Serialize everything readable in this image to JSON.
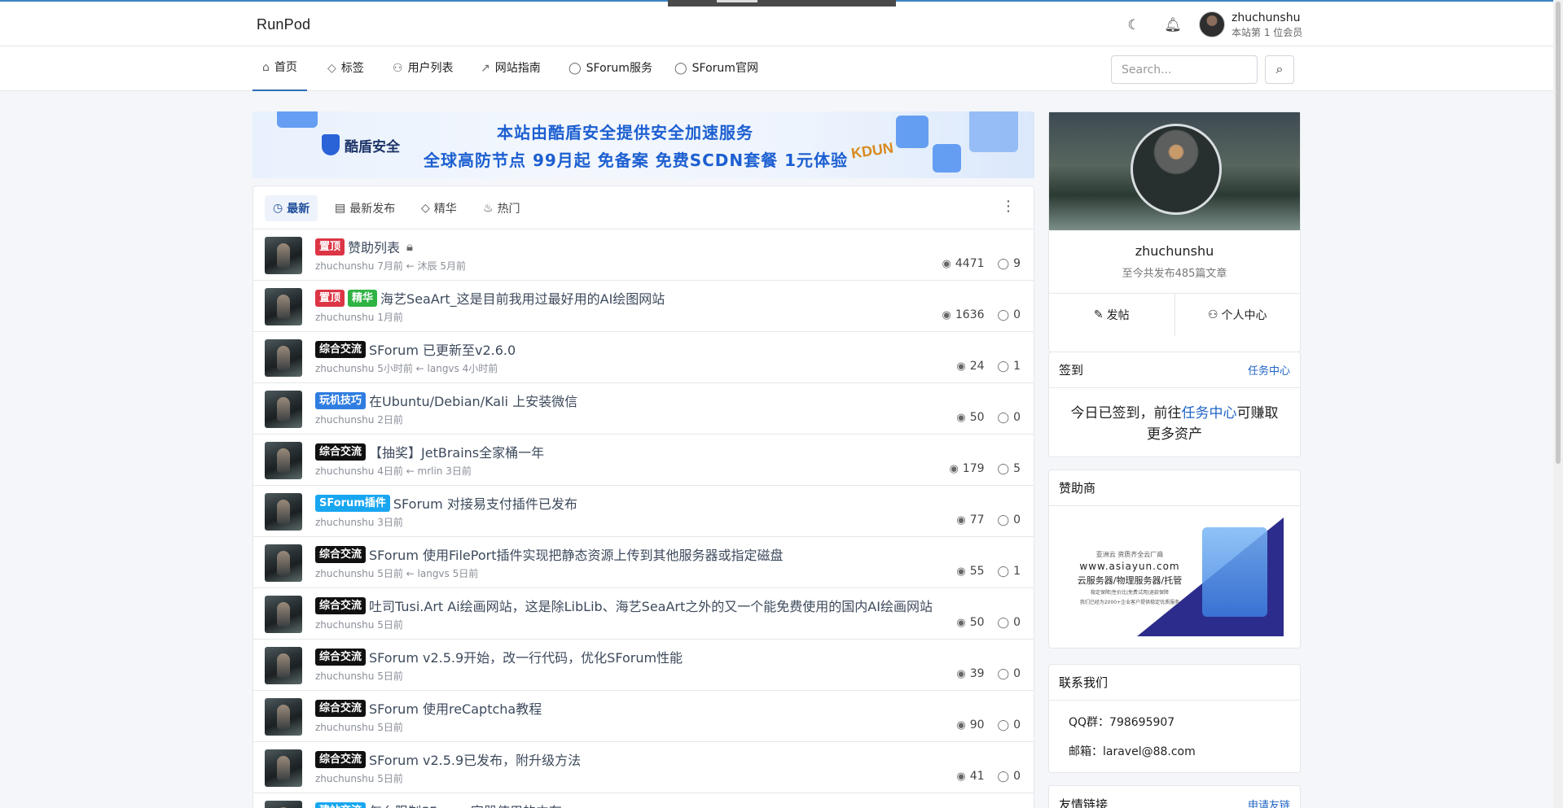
{
  "header": {
    "logo": "RunPod",
    "user_name": "zhuchunshu",
    "user_sub": "本站第 1 位会员",
    "theme_icon": "moon-icon",
    "notify_icon": "bell-icon"
  },
  "nav": {
    "items": [
      {
        "label": "首页",
        "icon": "home-icon"
      },
      {
        "label": "标签",
        "icon": "tag-icon"
      },
      {
        "label": "用户列表",
        "icon": "users-icon"
      },
      {
        "label": "网站指南",
        "icon": "route-icon"
      },
      {
        "label": "SForum服务",
        "icon": "chat-icon"
      },
      {
        "label": "SForum官网",
        "icon": "chat-icon"
      }
    ],
    "search_placeholder": "Search..."
  },
  "banner": {
    "brand": "酷盾安全",
    "line1": "本站由酷盾安全提供安全加速服务",
    "line2": "全球高防节点 99月起 免备案  免费SCDN套餐 1元体验",
    "badge": "KDUN"
  },
  "tabs": [
    {
      "label": "最新",
      "icon": "clock-icon"
    },
    {
      "label": "最新发布",
      "icon": "doc-icon"
    },
    {
      "label": "精华",
      "icon": "diamond-icon"
    },
    {
      "label": "热门",
      "icon": "flame-icon"
    }
  ],
  "posts": [
    {
      "tags": [
        {
          "text": "置顶",
          "color": "#dc3545"
        }
      ],
      "title": "赞助列表",
      "locked": true,
      "meta": "zhuchunshu 7月前 ← 沐辰 5月前",
      "views": "4471",
      "comments": "9"
    },
    {
      "tags": [
        {
          "text": "置顶",
          "color": "#dc3545"
        },
        {
          "text": "精华",
          "color": "#2fb344"
        }
      ],
      "title": "海艺SeaArt_这是目前我用过最好用的AI绘图网站",
      "locked": false,
      "meta": "zhuchunshu 1月前",
      "views": "1636",
      "comments": "0"
    },
    {
      "tags": [
        {
          "text": "综合交流",
          "color": "#111111"
        }
      ],
      "title": "SForum 已更新至v2.6.0",
      "locked": false,
      "meta": "zhuchunshu 5小时前 ← langvs 4小时前",
      "views": "24",
      "comments": "1"
    },
    {
      "tags": [
        {
          "text": "玩机技巧",
          "color": "#2f7de1"
        }
      ],
      "title": "在Ubuntu/Debian/Kali 上安装微信",
      "locked": false,
      "meta": "zhuchunshu 2日前",
      "views": "50",
      "comments": "0"
    },
    {
      "tags": [
        {
          "text": "综合交流",
          "color": "#111111"
        }
      ],
      "title": "【抽奖】JetBrains全家桶一年",
      "locked": false,
      "meta": "zhuchunshu 4日前 ← mrlin 3日前",
      "views": "179",
      "comments": "5"
    },
    {
      "tags": [
        {
          "text": "SForum插件",
          "color": "#19a6f1"
        }
      ],
      "title": "SForum 对接易支付插件已发布",
      "locked": false,
      "meta": "zhuchunshu 3日前",
      "views": "77",
      "comments": "0"
    },
    {
      "tags": [
        {
          "text": "综合交流",
          "color": "#111111"
        }
      ],
      "title": "SForum 使用FilePort插件实现把静态资源上传到其他服务器或指定磁盘",
      "locked": false,
      "meta": "zhuchunshu 5日前 ← langvs 5日前",
      "views": "55",
      "comments": "1"
    },
    {
      "tags": [
        {
          "text": "综合交流",
          "color": "#111111"
        }
      ],
      "title": "吐司Tusi.Art Ai绘画网站，这是除LibLib、海艺SeaArt之外的又一个能免费使用的国内AI绘画网站",
      "locked": false,
      "meta": "zhuchunshu 5日前",
      "views": "50",
      "comments": "0"
    },
    {
      "tags": [
        {
          "text": "综合交流",
          "color": "#111111"
        }
      ],
      "title": "SForum v2.5.9开始，改一行代码，优化SForum性能",
      "locked": false,
      "meta": "zhuchunshu 5日前",
      "views": "39",
      "comments": "0"
    },
    {
      "tags": [
        {
          "text": "综合交流",
          "color": "#111111"
        }
      ],
      "title": "SForum 使用reCaptcha教程",
      "locked": false,
      "meta": "zhuchunshu 5日前",
      "views": "90",
      "comments": "0"
    },
    {
      "tags": [
        {
          "text": "综合交流",
          "color": "#111111"
        }
      ],
      "title": "SForum v2.5.9已发布，附升级方法",
      "locked": false,
      "meta": "zhuchunshu 5日前",
      "views": "41",
      "comments": "0"
    },
    {
      "tags": [
        {
          "text": "建站交流",
          "color": "#19a6f1"
        }
      ],
      "title": "怎么限制SForum容器使用的内存",
      "locked": false,
      "meta": "",
      "views": "",
      "comments": ""
    }
  ],
  "sidebar": {
    "profile": {
      "name": "zhuchunshu",
      "sub": "至今共发布485篇文章",
      "btn_post": "发帖",
      "btn_center": "个人中心"
    },
    "checkin": {
      "title": "签到",
      "link": "任务中心",
      "text_a": "今日已签到，前往",
      "text_link": "任务中心",
      "text_b": "可赚取更多资产"
    },
    "sponsor": {
      "title": "赞助商",
      "ad_top": "亚洲云 资质齐全云厂商",
      "ad_url": "www.asiayun.com",
      "ad_main": "云服务器/物理服务器/托管",
      "ad_small1": "稳定保障|性价比|免费试用|退款保障",
      "ad_small2": "我们已经为2000+企业客户提供稳定优质服务"
    },
    "contact": {
      "title": "联系我们",
      "qq": "QQ群：798695907",
      "mail": "邮箱：laravel@88.com"
    },
    "links": {
      "title": "友情链接",
      "apply": "申请友链"
    }
  }
}
